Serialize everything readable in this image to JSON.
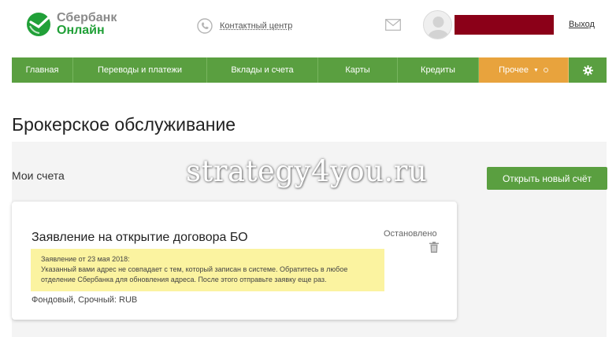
{
  "header": {
    "logo_line1": "Сбербанк",
    "logo_line2": "Онлайн",
    "contact_label": "Контактный центр",
    "logout_label": "Выход",
    "icons": {
      "logo": "sberbank-logo-icon",
      "phone": "phone-icon",
      "mail": "mail-icon",
      "avatar": "avatar-icon"
    }
  },
  "nav": {
    "items": [
      {
        "label": "Главная"
      },
      {
        "label": "Переводы и платежи"
      },
      {
        "label": "Вклады и счета"
      },
      {
        "label": "Карты"
      },
      {
        "label": "Кредиты"
      },
      {
        "label": "Прочее"
      }
    ],
    "settings_icon": "gear-icon"
  },
  "page": {
    "title": "Брокерское обслуживание",
    "my_accounts_label": "Мои счета",
    "open_account_button": "Открыть новый счёт",
    "watermark": "strategy4you.ru"
  },
  "card": {
    "title": "Заявление на открытие договора БО",
    "status": "Остановлено",
    "note_line1": "Заявление от 23 мая 2018:",
    "note_line2": "Указанный вами адрес не совпадает с тем, который записан в системе. Обратитесь в любое отделение Сбербанка для обновления адреса. После этого отправьте заявку еще раз.",
    "footer": "Фондовый, Срочный: RUB"
  },
  "colors": {
    "brand_green": "#5a9f40",
    "accent_orange": "#e8a33d",
    "username_redacted": "#8b0018",
    "note_yellow": "#fbf3a0"
  }
}
